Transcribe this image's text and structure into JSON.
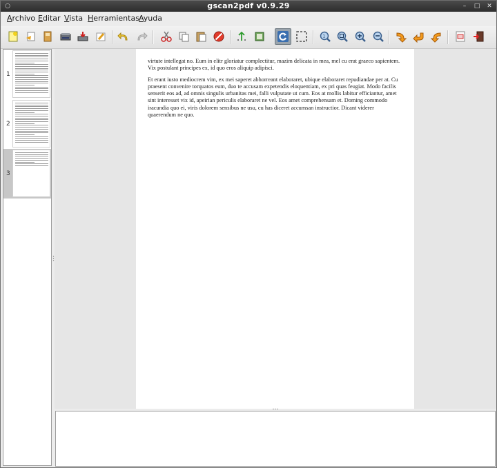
{
  "window": {
    "title": "gscan2pdf v0.9.29"
  },
  "menubar": {
    "items": [
      {
        "label": "Archivo",
        "mnemonic": "A",
        "rest": "rchivo"
      },
      {
        "label": "Editar",
        "mnemonic": "E",
        "rest": "ditar"
      },
      {
        "label": "Vista",
        "mnemonic": "V",
        "rest": "ista"
      },
      {
        "label": "Herramientas",
        "mnemonic": "H",
        "rest": "erramientas"
      },
      {
        "label": "Ayuda",
        "mnemonic": "A",
        "rest": "yuda"
      }
    ]
  },
  "toolbar": {
    "icons": [
      "new-icon",
      "open-icon",
      "save-icon",
      "scan-icon",
      "email-icon",
      "edit-icon",
      "undo-icon",
      "redo-icon",
      "cut-icon",
      "copy-icon",
      "paste-icon",
      "delete-icon",
      "renumber-icon",
      "select-all-icon",
      "rotate-view-icon",
      "select-rect-icon",
      "zoom-100-icon",
      "zoom-fit-icon",
      "zoom-in-icon",
      "zoom-out-icon",
      "rotate-90-icon",
      "rotate-180-icon",
      "rotate-270-icon",
      "clear-icon",
      "quit-icon"
    ],
    "active": "rotate-view-icon"
  },
  "thumbnails": {
    "pages": [
      {
        "number": "1",
        "selected": false
      },
      {
        "number": "2",
        "selected": false
      },
      {
        "number": "3",
        "selected": true
      }
    ]
  },
  "document": {
    "paragraphs": [
      "virtute intellegat no. Eum in elitr gloriatur complectitur, mazim delicata in mea, mel cu erat graeco sapientem. Vix postulant principes ex, id quo eros aliquip adipisci.",
      "Et erant iusto mediocrem vim, ex mei saperet abhorreant elaboraret, ubique elaboraret repudiandae per at. Cu praesent convenire torquatos eum, duo te accusam expetendis eloquentiam, ex pri quas feugiat. Modo facilis senserit eos ad, ad omnis singulis urbanitas mei, falli vulputate ut cum. Eos at mollis labitur efficiantur, amet sint interesset vix id, apeirian periculis elaboraret ne vel. Eos amet comprehensam et. Doming commodo iracundia quo ei, viris dolorem sensibus ne usu, cu has diceret accumsan instructior. Dicant viderer quaerendum ne quo."
    ]
  },
  "log": {
    "text": ""
  },
  "colors": {
    "titlebar": "#2d2d2d",
    "selection": "#c7c7c7",
    "active_tool": "#9aa4ad"
  }
}
